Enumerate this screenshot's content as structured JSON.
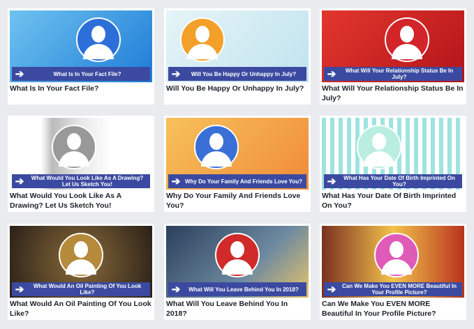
{
  "cards": [
    {
      "banner": "What Is In Your Fact File?",
      "title": "What Is In Your Fact File?",
      "bg": "linear-gradient(135deg,#6fc3f0,#1d7bd6)",
      "circle": "#2c6fd8"
    },
    {
      "banner": "Will You Be Happy Or Unhappy In July?",
      "title": "Will You Be Happy Or Unhappy In July?",
      "bg": "linear-gradient(135deg,#e6f4f8,#bfe3ee)",
      "circle": "#f2a02a"
    },
    {
      "banner": "What Will Your Relationship Status Be In July?",
      "title": "What Will Your Relationship Status Be In July?",
      "bg": "linear-gradient(135deg,#e2362d,#b3151a)",
      "circle": "#d3242a"
    },
    {
      "banner": "What Would You Look Like As A Drawing? Let Us Sketch You!",
      "title": "What Would You Look Like As A Drawing? Let Us Sketch You!",
      "bg": "linear-gradient(90deg,#fff 0%,#fff 22%,#bbb 30%,#e8e8e8 50%,#fff 72%)",
      "circle": "#999"
    },
    {
      "banner": "Why Do Your Family And Friends Love You?",
      "title": "Why Do Your Family And Friends Love You?",
      "bg": "linear-gradient(135deg,#f7c15a,#f08a3a)",
      "circle": "#3a6fd6"
    },
    {
      "banner": "What Has Your Date Of Birth Imprinted On You?",
      "title": "What Has Your Date Of Birth Imprinted On You?",
      "bg": "repeating-linear-gradient(90deg,#9fe3e0 0 6px,#fff 6px 12px)",
      "circle": "#b9eee0"
    },
    {
      "banner": "What Would An Oil Painting Of You Look Like?",
      "title": "What Would An Oil Painting Of You Look Like?",
      "bg": "radial-gradient(circle,#8a6b3a,#2a2018)",
      "circle": "#b58a3a"
    },
    {
      "banner": "What Will You Leave Behind You In 2018?",
      "title": "What Will You Leave Behind You In 2018?",
      "bg": "linear-gradient(135deg,#2a3f5c,#6e8aa0 60%,#e8c46a)",
      "circle": "#d02a2a"
    },
    {
      "banner": "Can We Make You EVEN MORE Beautiful In Your Profile Picture?",
      "title": "Can We Make You EVEN MORE Beautiful In Your Profile Picture?",
      "bg": "linear-gradient(90deg,#7a3020,#f3c24c 50%,#b8331e)",
      "circle": "#e05ab8"
    }
  ]
}
